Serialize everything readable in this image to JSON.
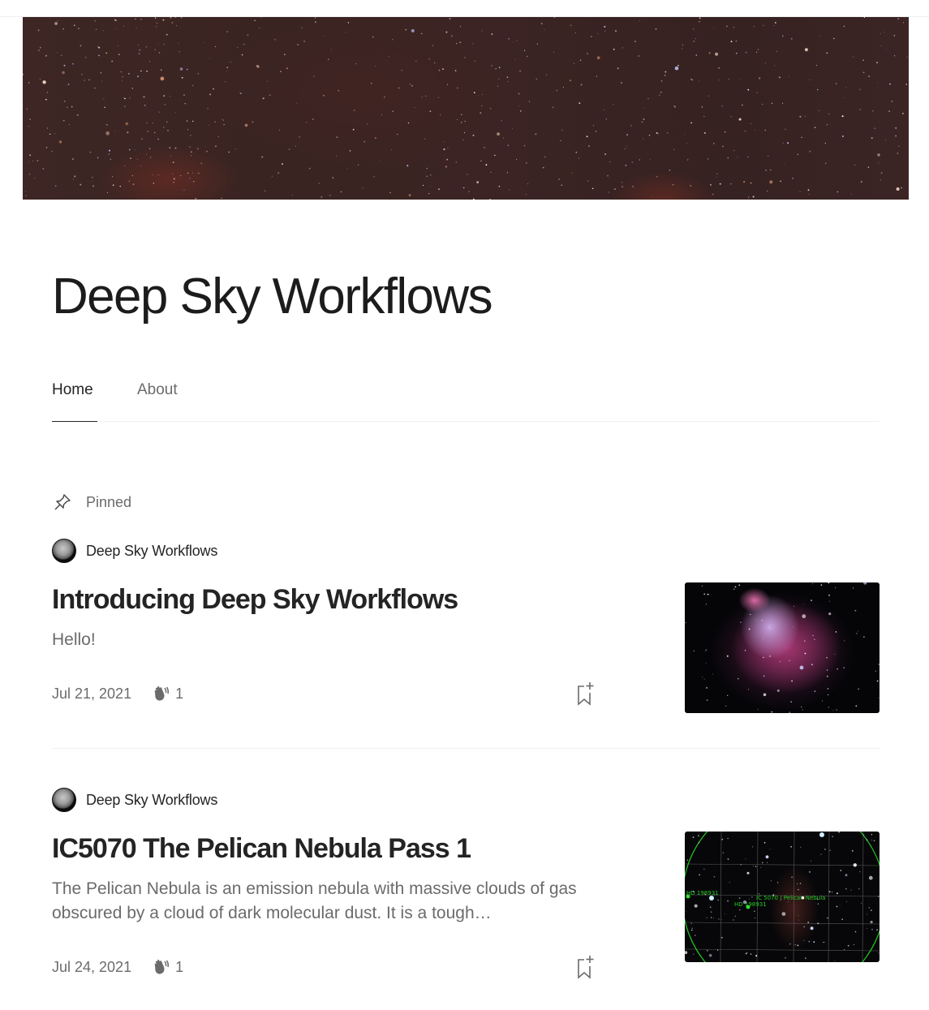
{
  "publication": {
    "title": "Deep Sky Workflows"
  },
  "nav": {
    "tabs": [
      {
        "label": "Home",
        "active": true
      },
      {
        "label": "About",
        "active": false
      }
    ]
  },
  "pinned_label": "Pinned",
  "icons": {
    "pin": "pin-icon",
    "clap": "clap-icon",
    "bookmark": "bookmark-add-icon",
    "avatar": "moon-avatar"
  },
  "articles": [
    {
      "author": "Deep Sky Workflows",
      "title": "Introducing Deep Sky Workflows",
      "subtitle": "Hello!",
      "date": "Jul 21, 2021",
      "claps": "1",
      "thumbnail": "Orion Nebula photo"
    },
    {
      "author": "Deep Sky Workflows",
      "title": "IC5070 The Pelican Nebula Pass 1",
      "subtitle": "The Pelican Nebula is an emission nebula with massive clouds of gas obscured by a cloud of dark molecular dust. It is a tough…",
      "date": "Jul 24, 2021",
      "claps": "1",
      "thumbnail": "Plate-solved star field with annotations",
      "thumbnail_labels": [
        "HD 198931",
        "IC 5070 / Pelican Nebula"
      ]
    }
  ],
  "colors": {
    "text_primary": "#242424",
    "text_secondary": "#6b6b6b",
    "divider": "#f0f0f0",
    "annotation_green": "#22cc22"
  }
}
